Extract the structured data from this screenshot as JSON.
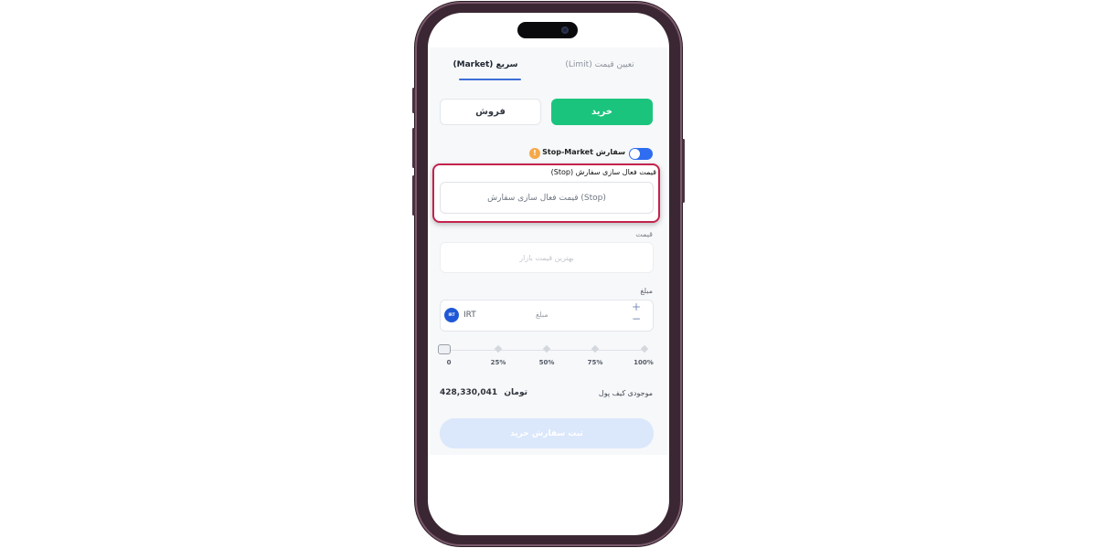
{
  "tabs": [
    {
      "label": "سریع (Market)",
      "active": true
    },
    {
      "label": "تعیین قیمت (Limit)",
      "active": false
    }
  ],
  "side": {
    "buy_label": "خرید",
    "sell_label": "فروش"
  },
  "stop_market": {
    "toggle_label": "سفارش Stop-Market",
    "enabled": true,
    "info_icon": "!"
  },
  "stop_price": {
    "label": "قیمت فعال سازی سفارش (Stop)",
    "placeholder": "(Stop) قیمت فعال سازی سفارش"
  },
  "price": {
    "label": "قیمت",
    "placeholder": "بهترین قیمت بازار"
  },
  "amount": {
    "label": "مبلغ",
    "placeholder": "مبلغ",
    "currency": "IRT",
    "currency_icon_text": "IRT",
    "plus": "+",
    "minus": "−"
  },
  "slider": {
    "ticks": [
      "0",
      "25%",
      "50%",
      "75%",
      "100%"
    ],
    "value_percent": 0
  },
  "wallet": {
    "label": "موجودی کیف پول",
    "value": "428,330,041",
    "unit": "تومان"
  },
  "submit_label": "ثبت سفارش خرید",
  "colors": {
    "buy": "#1bc47d",
    "accent": "#2f6df0",
    "highlight_border": "#c4234d",
    "submit_disabled": "#dbe7fb",
    "phone_frame": "#3b2733"
  }
}
